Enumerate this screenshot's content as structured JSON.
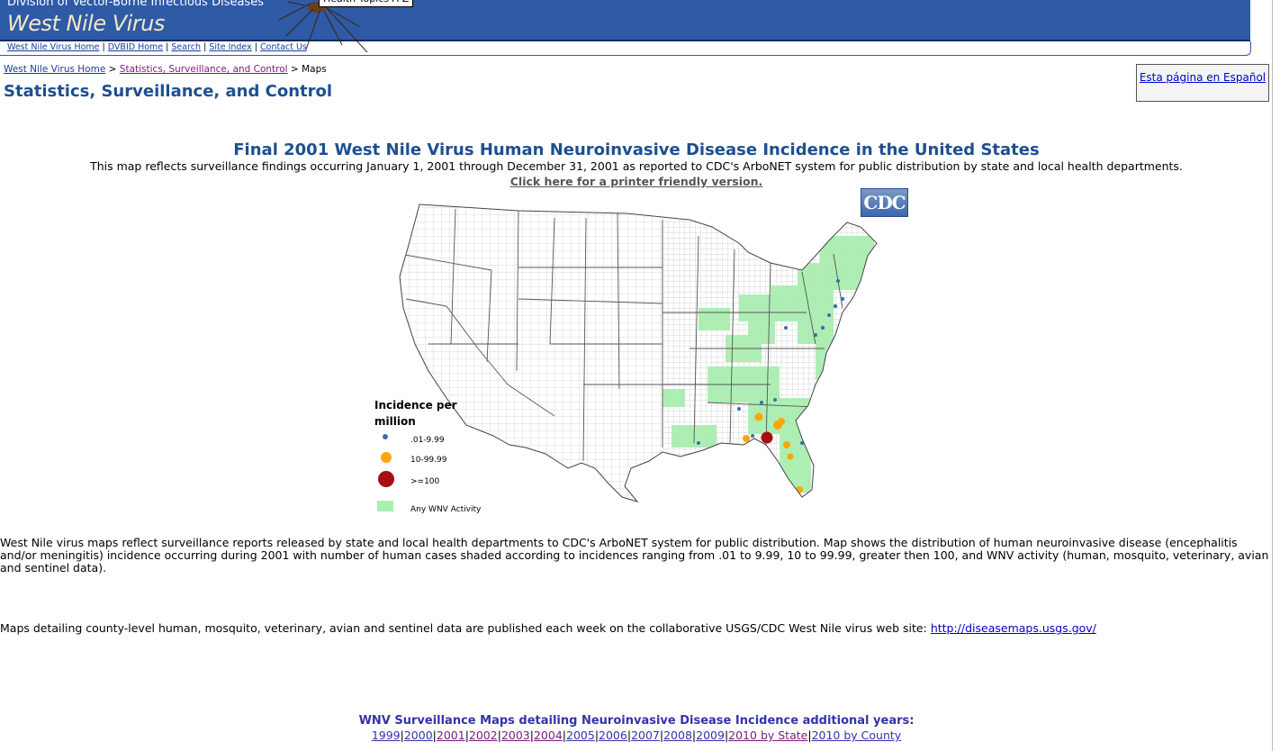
{
  "banner": {
    "division": "Division of Vector-Borne Infectious Diseases",
    "site_title": "West Nile Virus",
    "topics_button": "Health Topics A-Z"
  },
  "nav": {
    "links": [
      "West Nile Virus Home",
      "DVBID Home",
      "Search",
      "Site Index",
      "Contact Us"
    ],
    "separator": "|"
  },
  "breadcrumb": {
    "home": "West Nile Virus Home",
    "section": "Statistics, Surveillance, and Control",
    "current": "Maps",
    "separator": ">"
  },
  "page_title": "Statistics, Surveillance, and Control",
  "spanish_link": "Esta página en Español",
  "map": {
    "heading": "Final 2001 West Nile Virus Human Neuroinvasive Disease Incidence in the United States",
    "description": "This map reflects surveillance findings occurring January 1, 2001 through December 31, 2001 as reported to CDC's ArboNET system for public distribution by state and local health departments.",
    "printer_link": "Click here for a printer friendly version.",
    "logo_text": "CDC",
    "legend": {
      "title": "Incidence per million",
      "items": [
        {
          "label": ".01-9.99",
          "color": "#3a6fb0"
        },
        {
          "label": "10-99.99",
          "color": "#ffa500"
        },
        {
          "label": ">=100",
          "color": "#a50f0f"
        },
        {
          "label": "Any WNV Activity",
          "color": "#aaeeb0"
        }
      ]
    }
  },
  "body_paragraph": "West Nile virus maps reflect surveillance reports released by state and local health departments to CDC's ArboNET system for public distribution. Map shows the distribution of human neuroinvasive disease (encephalitis and/or meningitis) incidence occurring during 2001 with number of human cases shaded according to incidences ranging from .01 to 9.99, 10 to 99.99, greater then 100, and WNV activity (human, mosquito, veterinary, avian and sentinel data).",
  "maps_detail": {
    "text": "Maps detailing county-level human, mosquito, veterinary, avian and sentinel data are published each week on the collaborative USGS/CDC West Nile virus web site:",
    "link": "http://diseasemaps.usgs.gov/"
  },
  "more_years": {
    "heading": "WNV Surveillance Maps detailing Neuroinvasive Disease Incidence additional years:",
    "links": [
      "1999",
      "2000",
      "2001",
      "2002",
      "2003",
      "2004",
      "2005",
      "2006",
      "2007",
      "2008",
      "2009",
      "2010 by State",
      "2010 by County"
    ]
  }
}
